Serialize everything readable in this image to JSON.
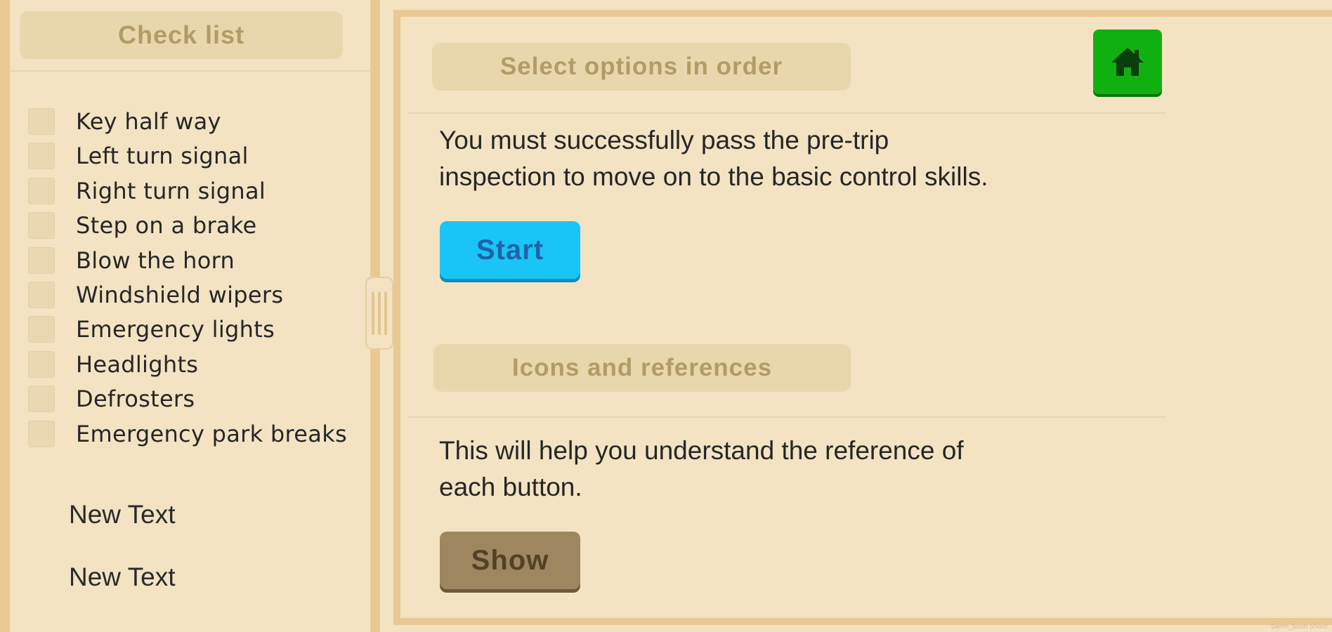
{
  "sidebar": {
    "title": "Check list",
    "items": [
      {
        "label": "Key half way",
        "checked": false
      },
      {
        "label": "Left turn signal",
        "checked": false
      },
      {
        "label": "Right turn signal",
        "checked": false
      },
      {
        "label": "Step on a brake",
        "checked": false
      },
      {
        "label": "Blow the horn",
        "checked": false
      },
      {
        "label": "Windshield wipers",
        "checked": false
      },
      {
        "label": "Emergency lights",
        "checked": false
      },
      {
        "label": "Headlights",
        "checked": false
      },
      {
        "label": "Defrosters",
        "checked": false
      },
      {
        "label": "Emergency park breaks",
        "checked": false
      }
    ],
    "footer_texts": [
      "New Text",
      "New Text"
    ]
  },
  "main": {
    "section1": {
      "header": "Select options in order",
      "text_line1": "You must successfully pass the pre-trip",
      "text_line2": "inspection to move on to the basic control skills.",
      "button_label": "Start"
    },
    "section2": {
      "header": "Icons and references",
      "text_line1": "This will help you understand the reference of",
      "text_line2": "each button.",
      "button_label": "Show"
    },
    "home_icon": "home-icon"
  },
  "colors": {
    "background": "#f3e3c3",
    "frame": "#e8c994",
    "header_bg": "#e8d7ad",
    "header_text": "#b29b66",
    "start_button": "#19c5f7",
    "show_button": "#9e8760",
    "home_button": "#11b011"
  },
  "watermark": "Derm_Soon Shoot"
}
